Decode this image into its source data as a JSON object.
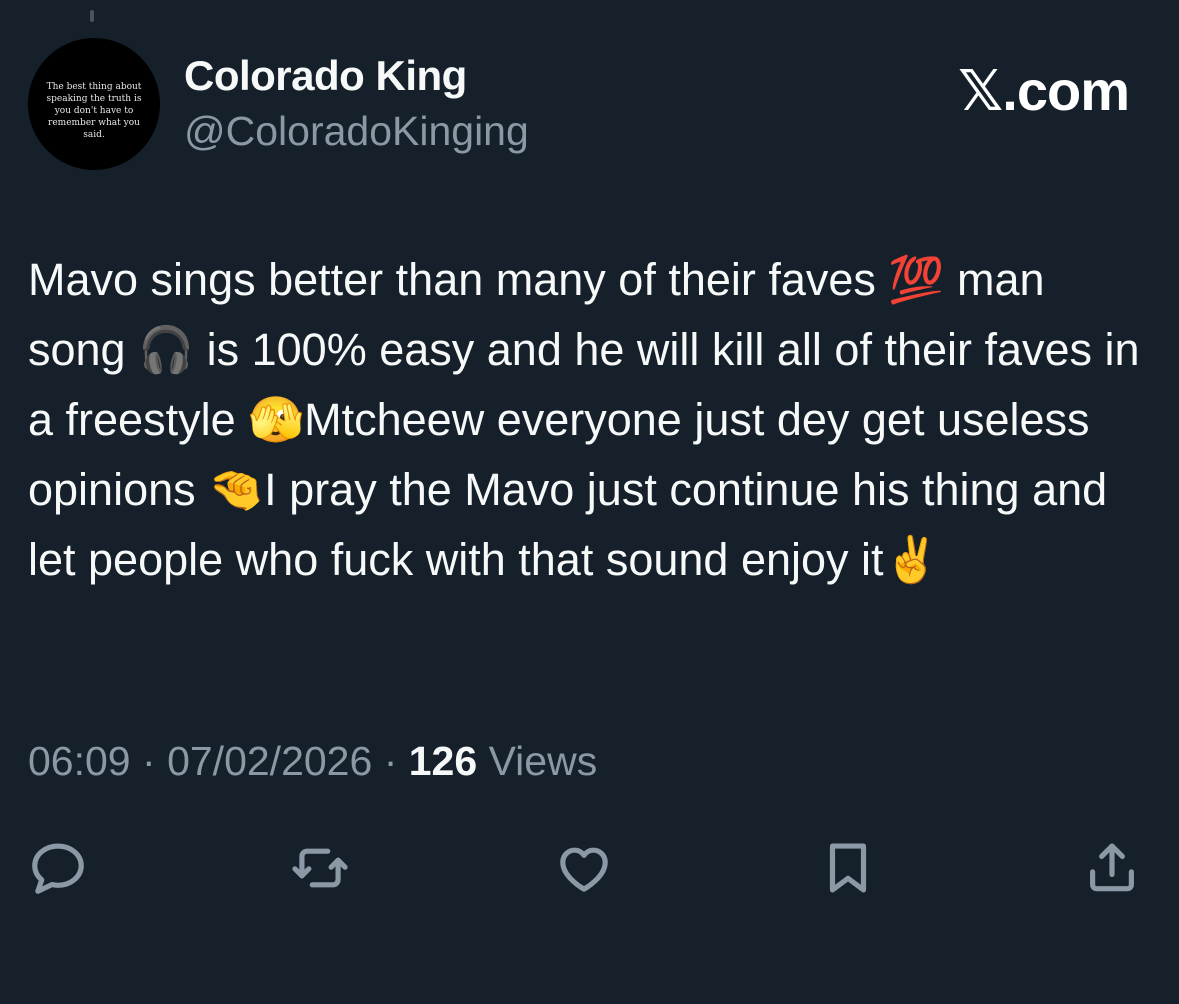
{
  "author": {
    "display_name": "Colorado King",
    "handle": "@ColoradoKinging",
    "avatar_text": "The best thing about speaking the truth is you don't have to remember what you said."
  },
  "brand": {
    "label": "𝕏.com"
  },
  "tweet": {
    "text": "Mavo sings better than many of their faves 💯 man song 🎧 is 100% easy and he will kill all of their faves in a freestyle 🫣Mtcheew everyone just dey get useless opinions 🤏I pray the Mavo just continue his thing and let people who fuck with that sound enjoy it✌️",
    "time": "06:09",
    "date": "07/02/2026",
    "separator": "·",
    "views_count": "126",
    "views_label": "Views"
  },
  "actions": [
    {
      "name": "reply",
      "icon": "reply-icon"
    },
    {
      "name": "retweet",
      "icon": "retweet-icon"
    },
    {
      "name": "like",
      "icon": "heart-icon"
    },
    {
      "name": "bookmark",
      "icon": "bookmark-icon"
    },
    {
      "name": "share",
      "icon": "share-icon"
    }
  ],
  "colors": {
    "background": "#15202b",
    "primary_text": "#f7f9f9",
    "secondary_text": "#8b98a5"
  }
}
